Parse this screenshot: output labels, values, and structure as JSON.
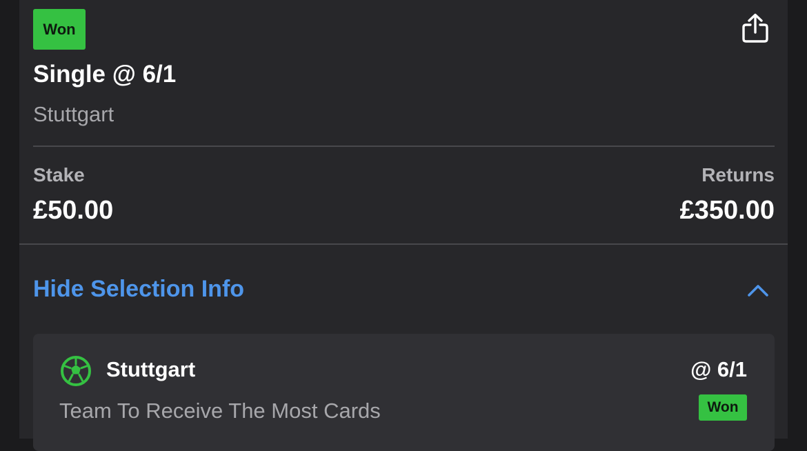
{
  "bet": {
    "status": "Won",
    "title": "Single @ 6/1",
    "subtitle": "Stuttgart"
  },
  "totals": {
    "stake_label": "Stake",
    "stake_value": "£50.00",
    "returns_label": "Returns",
    "returns_value": "£350.00"
  },
  "selection_toggle": {
    "label": "Hide Selection Info",
    "icon": "chevron-up-icon"
  },
  "selection": {
    "icon": "football-icon",
    "name": "Stuttgart",
    "odds": "@ 6/1",
    "market": "Team To Receive The Most Cards",
    "status": "Won"
  },
  "icons": {
    "share": "share-icon"
  },
  "colors": {
    "won_badge": "#35c142",
    "link": "#4e95ea",
    "card_bg": "#27272a",
    "selection_bg": "#303034",
    "football": "#35c142"
  }
}
